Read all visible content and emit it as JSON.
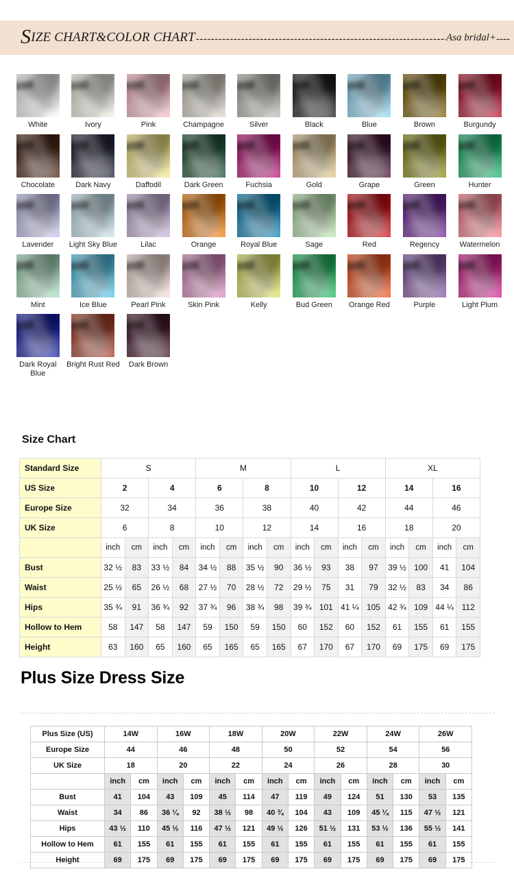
{
  "banner": {
    "title_drop": "S",
    "title_rest": "IZE CHART&COLOR CHART",
    "dashes": "------------------------------------------------------------------------------------------",
    "brand": "Asa bridal+",
    "dashes_end": "----",
    "bg_color": "#f2e0d0"
  },
  "colors": {
    "heading": "",
    "swatches": [
      {
        "name": "White",
        "hex": "#f7f7f7"
      },
      {
        "name": "Ivory",
        "hex": "#f2f0e2"
      },
      {
        "name": "Pink",
        "hex": "#f9b8c4"
      },
      {
        "name": "Champagne",
        "hex": "#d9d2c6"
      },
      {
        "name": "Silver",
        "hex": "#b7b8ae"
      },
      {
        "name": "Black",
        "hex": "#1d1d1d"
      },
      {
        "name": "Blue",
        "hex": "#8fd8f4"
      },
      {
        "name": "Brown",
        "hex": "#7d6107"
      },
      {
        "name": "Burgundy",
        "hex": "#b5102c"
      },
      {
        "name": "Chocolate",
        "hex": "#4a2413"
      },
      {
        "name": "Dark Navy",
        "hex": "#22243a"
      },
      {
        "name": "Daffodil",
        "hex": "#f4e581"
      },
      {
        "name": "Dark Green",
        "hex": "#1d5435"
      },
      {
        "name": "Fuchsia",
        "hex": "#bd1077"
      },
      {
        "name": "Gold",
        "hex": "#ddc488"
      },
      {
        "name": "Grape",
        "hex": "#471330"
      },
      {
        "name": "Green",
        "hex": "#8a8a16"
      },
      {
        "name": "Hunter",
        "hex": "#13b26a"
      },
      {
        "name": "Lavender",
        "hex": "#c1c2ed"
      },
      {
        "name": "Light Sky Blue",
        "hex": "#c4e5ee"
      },
      {
        "name": "Lilac",
        "hex": "#c8b3dd"
      },
      {
        "name": "Orange",
        "hex": "#ef7e0b"
      },
      {
        "name": "Royal Blue",
        "hex": "#0a85b9"
      },
      {
        "name": "Sage",
        "hex": "#b9e3ae"
      },
      {
        "name": "Red",
        "hex": "#cf0d14"
      },
      {
        "name": "Regency",
        "hex": "#6c2596"
      },
      {
        "name": "Watermelon",
        "hex": "#f87a85"
      },
      {
        "name": "Mint",
        "hex": "#a3ddb9"
      },
      {
        "name": "Ice Blue",
        "hex": "#51c5ea"
      },
      {
        "name": "Pearl Pink",
        "hex": "#f4ddd2"
      },
      {
        "name": "Skin Pink",
        "hex": "#d987bd"
      },
      {
        "name": "Kelly",
        "hex": "#dde05f"
      },
      {
        "name": "Bud Green",
        "hex": "#1fbb5f"
      },
      {
        "name": "Orange Red",
        "hex": "#f4511b"
      },
      {
        "name": "Purple",
        "hex": "#8254a5"
      },
      {
        "name": "Light Plum",
        "hex": "#d51f8e"
      },
      {
        "name": "Dark Royal Blue",
        "hex": "#151ea8"
      },
      {
        "name": "Bright Rust Red",
        "hex": "#a8412a"
      },
      {
        "name": "Dark Brown",
        "hex": "#43172c"
      }
    ]
  },
  "size_chart": {
    "heading": "Size Chart",
    "standard_label": "Standard Size",
    "standard_sizes": [
      "S",
      "M",
      "L",
      "XL"
    ],
    "rows": [
      {
        "label": "US Size",
        "values": [
          "2",
          "4",
          "6",
          "8",
          "10",
          "12",
          "14",
          "16"
        ]
      },
      {
        "label": "Europe Size",
        "values": [
          "32",
          "34",
          "36",
          "38",
          "40",
          "42",
          "44",
          "46"
        ]
      },
      {
        "label": "UK Size",
        "values": [
          "6",
          "8",
          "10",
          "12",
          "14",
          "16",
          "18",
          "20"
        ]
      }
    ],
    "unit_label": "",
    "units": [
      "inch",
      "cm",
      "inch",
      "cm",
      "inch",
      "cm",
      "inch",
      "cm",
      "inch",
      "cm",
      "inch",
      "cm",
      "inch",
      "cm",
      "inch",
      "cm"
    ],
    "measurements": [
      {
        "label": "Bust",
        "values": [
          "32 ½",
          "83",
          "33 ½",
          "84",
          "34 ½",
          "88",
          "35 ½",
          "90",
          "36 ½",
          "93",
          "38",
          "97",
          "39 ½",
          "100",
          "41",
          "104"
        ]
      },
      {
        "label": "Waist",
        "values": [
          "25 ½",
          "65",
          "26 ½",
          "68",
          "27 ½",
          "70",
          "28 ½",
          "72",
          "29 ½",
          "75",
          "31",
          "79",
          "32 ½",
          "83",
          "34",
          "86"
        ]
      },
      {
        "label": "Hips",
        "values": [
          "35 ¾",
          "91",
          "36 ¾",
          "92",
          "37 ¾",
          "96",
          "38 ¾",
          "98",
          "39 ¾",
          "101",
          "41 ¼",
          "105",
          "42 ¾",
          "109",
          "44 ¼",
          "112"
        ]
      },
      {
        "label": "Hollow to Hem",
        "values": [
          "58",
          "147",
          "58",
          "147",
          "59",
          "150",
          "59",
          "150",
          "60",
          "152",
          "60",
          "152",
          "61",
          "155",
          "61",
          "155"
        ]
      },
      {
        "label": "Height",
        "values": [
          "63",
          "160",
          "65",
          "160",
          "65",
          "165",
          "65",
          "165",
          "67",
          "170",
          "67",
          "170",
          "69",
          "175",
          "69",
          "175"
        ]
      }
    ]
  },
  "plus_size": {
    "heading": "Plus Size Dress Size",
    "rows": [
      {
        "label": "Plus Size (US)",
        "values": [
          "14W",
          "16W",
          "18W",
          "20W",
          "22W",
          "24W",
          "26W"
        ]
      },
      {
        "label": "Europe Size",
        "values": [
          "44",
          "46",
          "48",
          "50",
          "52",
          "54",
          "56"
        ]
      },
      {
        "label": "UK Size",
        "values": [
          "18",
          "20",
          "22",
          "24",
          "26",
          "28",
          "30"
        ]
      }
    ],
    "unit_label": "",
    "units": [
      "inch",
      "cm",
      "inch",
      "cm",
      "inch",
      "cm",
      "inch",
      "cm",
      "inch",
      "cm",
      "inch",
      "cm",
      "inch",
      "cm"
    ],
    "measurements": [
      {
        "label": "Bust",
        "values": [
          "41",
          "104",
          "43",
          "109",
          "45",
          "114",
          "47",
          "119",
          "49",
          "124",
          "51",
          "130",
          "53",
          "135"
        ]
      },
      {
        "label": "Waist",
        "values": [
          "34",
          "86",
          "36 ¼",
          "92",
          "38 ½",
          "98",
          "40 ¾",
          "104",
          "43",
          "109",
          "45 ¼",
          "115",
          "47 ½",
          "121"
        ]
      },
      {
        "label": "Hips",
        "values": [
          "43 ½",
          "110",
          "45 ½",
          "116",
          "47 ½",
          "121",
          "49 ½",
          "126",
          "51 ½",
          "131",
          "53 ½",
          "136",
          "55 ½",
          "141"
        ]
      },
      {
        "label": "Hollow to Hem",
        "values": [
          "61",
          "155",
          "61",
          "155",
          "61",
          "155",
          "61",
          "155",
          "61",
          "155",
          "61",
          "155",
          "61",
          "155"
        ]
      },
      {
        "label": "Height",
        "values": [
          "69",
          "175",
          "69",
          "175",
          "69",
          "175",
          "69",
          "175",
          "69",
          "175",
          "69",
          "175",
          "69",
          "175"
        ]
      }
    ]
  }
}
